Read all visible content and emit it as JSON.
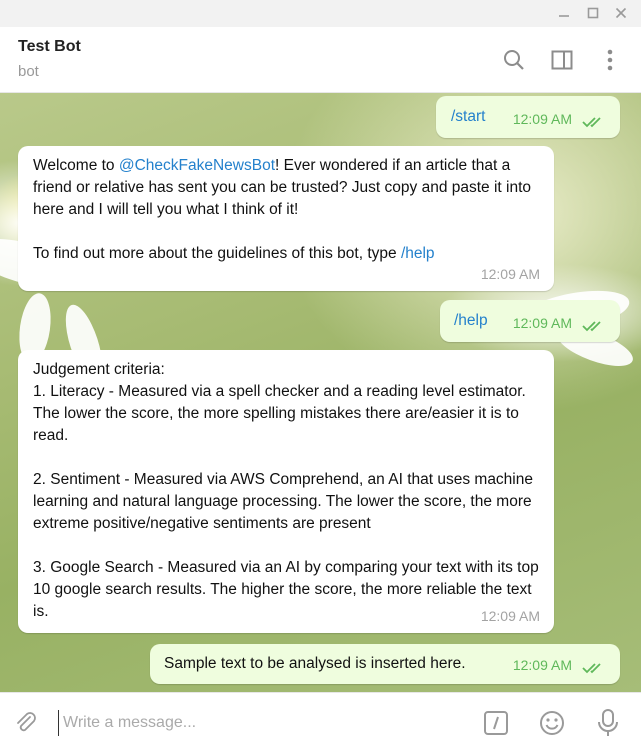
{
  "header": {
    "title": "Test Bot",
    "subtitle": "bot"
  },
  "icons": {
    "minimize": "minimize-icon",
    "maximize": "maximize-icon",
    "close": "close-icon",
    "search": "search-icon",
    "sidebar": "sidebar-toggle-icon",
    "more": "more-vertical-icon",
    "attach": "paperclip-icon",
    "commands": "bot-commands-icon",
    "emoji": "emoji-icon",
    "mic": "microphone-icon"
  },
  "colors": {
    "link": "#2481cc",
    "outgoing_bubble": "#effdde",
    "read_check": "#5fb85a",
    "time_incoming": "#a3a3a3"
  },
  "messages": [
    {
      "direction": "out",
      "text": "/start",
      "time": "12:09 AM",
      "status": "read"
    },
    {
      "direction": "in",
      "text_1": "Welcome to ",
      "mention": "@CheckFakeNewsBot",
      "text_2": "! Ever wondered if an article that a friend or relative has sent you can be trusted? Just copy and paste it into here and I will tell you what I think of it!",
      "text_3": "To find out more about the guidelines of this bot, type ",
      "command": "/help",
      "time": "12:09 AM"
    },
    {
      "direction": "out",
      "text": "/help",
      "time": "12:09 AM",
      "status": "read"
    },
    {
      "direction": "in",
      "text": "Judgement criteria:\n1. Literacy - Measured via a spell checker and a reading level estimator. The lower the score, the more spelling mistakes there are/easier it is to read.\n\n2. Sentiment - Measured via AWS Comprehend, an AI that uses machine learning and natural language processing. The lower the score, the more extreme positive/negative sentiments are present\n\n3. Google Search - Measured via an AI by comparing your text with its top 10 google search results. The higher the score, the more reliable the text is.",
      "time": "12:09 AM"
    },
    {
      "direction": "out",
      "text": "Sample text to be analysed is inserted here.",
      "time": "12:09 AM",
      "status": "read"
    }
  ],
  "composer": {
    "placeholder": "Write a message..."
  }
}
